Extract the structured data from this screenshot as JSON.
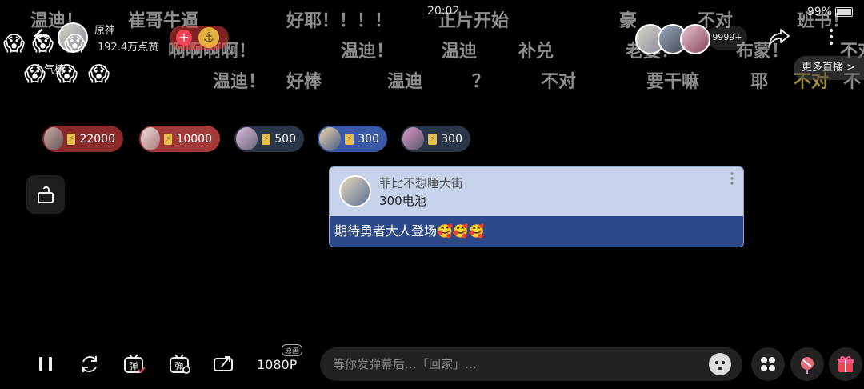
{
  "status": {
    "time": "20:02",
    "battery": "99%"
  },
  "danmaku": [
    {
      "text": "温迪！",
      "style": "w"
    },
    {
      "text": "崔哥牛逼",
      "style": "w"
    },
    {
      "text": "好耶！！！！",
      "style": "w"
    },
    {
      "text": "正片开始",
      "style": "w"
    },
    {
      "text": "豪",
      "style": "w"
    },
    {
      "text": "不对",
      "style": "w"
    },
    {
      "text": "班书！",
      "style": "w"
    },
    {
      "text": "啊啊啊啊！",
      "style": "w"
    },
    {
      "text": "温迪！",
      "style": "w"
    },
    {
      "text": "温迪",
      "style": "w"
    },
    {
      "text": "补兑",
      "style": "w"
    },
    {
      "text": "老婆！",
      "style": "w"
    },
    {
      "text": "布蒙！",
      "style": "w"
    },
    {
      "text": "不对",
      "style": "w"
    },
    {
      "text": "温迪！",
      "style": "w"
    },
    {
      "text": "好棒",
      "style": "w"
    },
    {
      "text": "温迪",
      "style": "w"
    },
    {
      "text": "？",
      "style": "w"
    },
    {
      "text": "不对",
      "style": "w"
    },
    {
      "text": "要干嘛",
      "style": "w"
    },
    {
      "text": "耶",
      "style": "w"
    },
    {
      "text": "不对",
      "style": "y"
    },
    {
      "text": "不",
      "style": "w"
    }
  ],
  "header": {
    "host_name": "原神",
    "likes": "192.4万点赞",
    "follow_plus": "+",
    "anchor_icon": "⚓",
    "rank_label": "人气榜",
    "emoji_pile": [
      "😱",
      "😱",
      "😱",
      "😱",
      "😱",
      "😱",
      "😱"
    ],
    "viewer_count": "9999+",
    "more_live": "更多直播 >"
  },
  "gifts": [
    {
      "amount": "22000",
      "color": "#8a2a2a"
    },
    {
      "amount": "10000",
      "color": "#a33a3a"
    },
    {
      "amount": "500",
      "color": "#2a3548"
    },
    {
      "amount": "300",
      "color": "#3a5aa8"
    },
    {
      "amount": "300",
      "color": "#2a3548"
    }
  ],
  "super_chat": {
    "name": "菲比不想睡大街",
    "amount": "300电池",
    "message": "期待勇者大人登场🥰🥰🥰"
  },
  "bottom": {
    "resolution": "1080P",
    "resolution_badge": "原画",
    "input_placeholder": "等你发弹幕后…「回家」…"
  },
  "colors": {
    "sc_top": "#c6d3ea",
    "sc_bottom": "#2c4a8a",
    "accent_red": "#e45"
  }
}
